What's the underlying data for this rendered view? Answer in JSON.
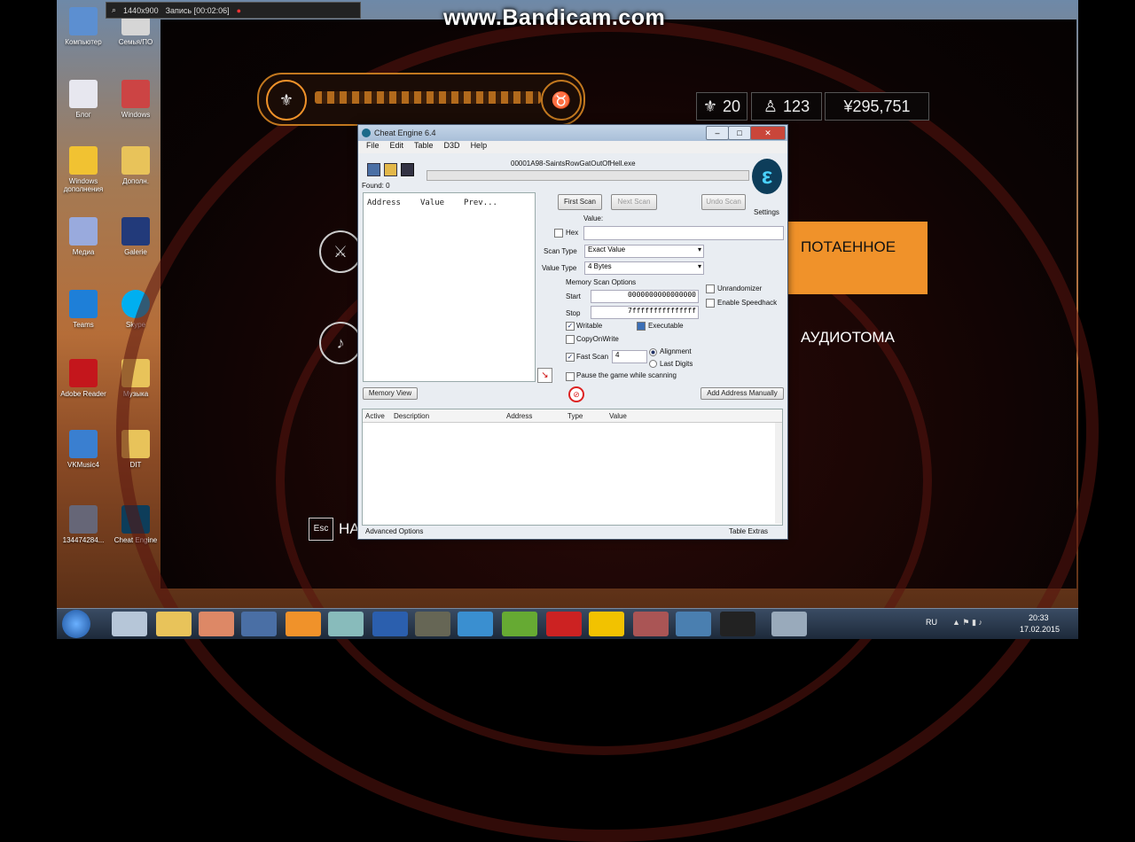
{
  "watermark": "www.Bandicam.com",
  "recorder_bar": {
    "resolution": "1440x900",
    "status": "Запись [00:02:06]"
  },
  "desktop_icons": [
    {
      "label": "Компьютер"
    },
    {
      "label": "Семья/ПО"
    },
    {
      "label": "Блог"
    },
    {
      "label": "Windows"
    },
    {
      "label": "Windows дополнения"
    },
    {
      "label": "Дополн."
    },
    {
      "label": "Медиа"
    },
    {
      "label": "Galerie"
    },
    {
      "label": "Teams"
    },
    {
      "label": "Skype"
    },
    {
      "label": "Adobe Reader"
    },
    {
      "label": "Музыка"
    },
    {
      "label": "VKMusic4"
    },
    {
      "label": "DIT"
    },
    {
      "label": "134474284..."
    },
    {
      "label": "Cheat Engine"
    }
  ],
  "game": {
    "stats": {
      "fleur": "20",
      "respect": "123",
      "money": "¥295,751"
    },
    "menu_highlight": "ПОТАЕННОЕ",
    "menu_second": "АУДИОТОМА",
    "esc_label": "Esc",
    "esc_text": "НА"
  },
  "ce": {
    "title": "Cheat Engine 6.4",
    "menu": [
      "File",
      "Edit",
      "Table",
      "D3D",
      "Help"
    ],
    "process": "00001A98-SaintsRowGatOutOfHell.exe",
    "found": "Found: 0",
    "list_headers": [
      "Address",
      "Value",
      "Prev..."
    ],
    "buttons": {
      "first_scan": "First Scan",
      "next_scan": "Next Scan",
      "undo_scan": "Undo Scan",
      "memory_view": "Memory View",
      "add_address": "Add Address Manually"
    },
    "settings": "Settings",
    "value_label": "Value:",
    "hex_label": "Hex",
    "scan_type_label": "Scan Type",
    "scan_type_value": "Exact Value",
    "value_type_label": "Value Type",
    "value_type_value": "4 Bytes",
    "mem_options": "Memory Scan Options",
    "start_label": "Start",
    "start_value": "0000000000000000",
    "stop_label": "Stop",
    "stop_value": "7fffffffffffffff",
    "writable": "Writable",
    "executable": "Executable",
    "copyonwrite": "CopyOnWrite",
    "fastscan": "Fast Scan",
    "fastscan_value": "4",
    "alignment": "Alignment",
    "lastdigits": "Last Digits",
    "pause": "Pause the game while scanning",
    "unrandomizer": "Unrandomizer",
    "speedhack": "Enable Speedhack",
    "table_headers": [
      "Active",
      "Description",
      "Address",
      "Type",
      "Value"
    ],
    "advanced": "Advanced Options",
    "table_extras": "Table Extras"
  },
  "tray": {
    "lang": "RU",
    "time": "20:33",
    "date": "17.02.2015"
  }
}
